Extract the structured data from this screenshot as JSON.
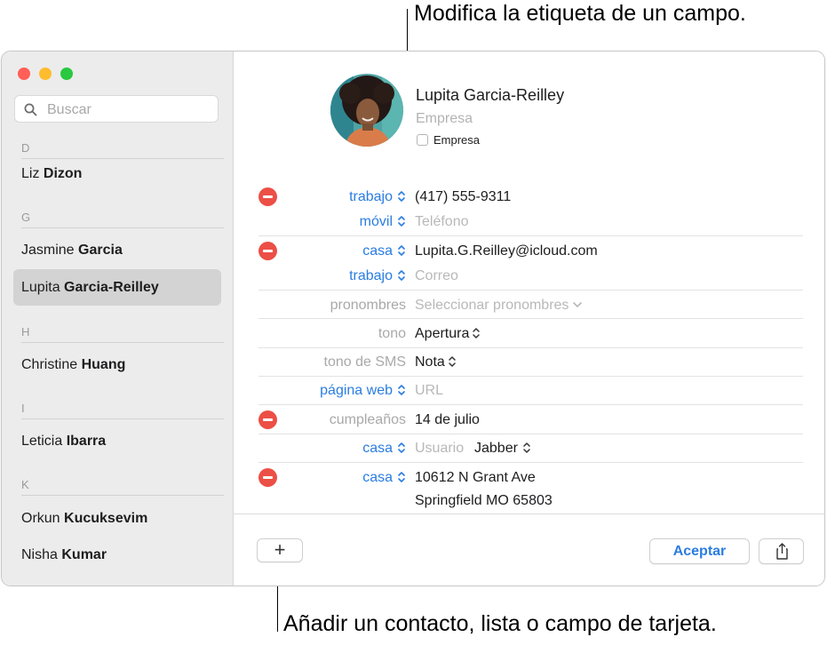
{
  "callouts": {
    "top": "Modifica la etiqueta de un campo.",
    "bottom": "Añadir un contacto, lista o campo de tarjeta."
  },
  "colors": {
    "close": "#ff5f57",
    "minimize": "#febc2e",
    "zoom": "#28c840",
    "accent": "#2a7de1",
    "delete": "#ec4f46"
  },
  "sidebar": {
    "search_placeholder": "Buscar",
    "sections": [
      {
        "letter": "D",
        "contacts": [
          {
            "first": "Liz",
            "last": "Dizon"
          }
        ]
      },
      {
        "letter": "G",
        "contacts": [
          {
            "first": "Jasmine",
            "last": "Garcia"
          },
          {
            "first": "Lupita",
            "last": "Garcia-Reilley",
            "selected": true
          }
        ]
      },
      {
        "letter": "H",
        "contacts": [
          {
            "first": "Christine",
            "last": "Huang"
          }
        ]
      },
      {
        "letter": "I",
        "contacts": [
          {
            "first": "Leticia",
            "last": "Ibarra"
          }
        ]
      },
      {
        "letter": "K",
        "contacts": [
          {
            "first": "Orkun",
            "last": "Kucuksevim"
          },
          {
            "first": "Nisha",
            "last": "Kumar"
          }
        ]
      }
    ]
  },
  "card": {
    "name": "Lupita  Garcia-Reilley",
    "company_placeholder": "Empresa",
    "company_checkbox_label": "Empresa",
    "fields": {
      "phone1_label": "trabajo",
      "phone1_value": "(417) 555-9311",
      "phone2_label": "móvil",
      "phone2_placeholder": "Teléfono",
      "email1_label": "casa",
      "email1_value": "Lupita.G.Reilley@icloud.com",
      "email2_label": "trabajo",
      "email2_placeholder": "Correo",
      "pronouns_label": "pronombres",
      "pronouns_placeholder": "Seleccionar pronombres",
      "ringtone_label": "tono",
      "ringtone_value": "Apertura",
      "texttone_label": "tono de SMS",
      "texttone_value": "Nota",
      "url_label": "página web",
      "url_placeholder": "URL",
      "birthday_label": "cumpleaños",
      "birthday_value": "14 de julio",
      "im_label": "casa",
      "im_user_placeholder": "Usuario",
      "im_service": "Jabber",
      "address_label": "casa",
      "address_line1": "10612 N Grant Ave",
      "address_line2": "Springfield MO 65803"
    }
  },
  "footer": {
    "add_label": "+",
    "accept_label": "Aceptar"
  }
}
